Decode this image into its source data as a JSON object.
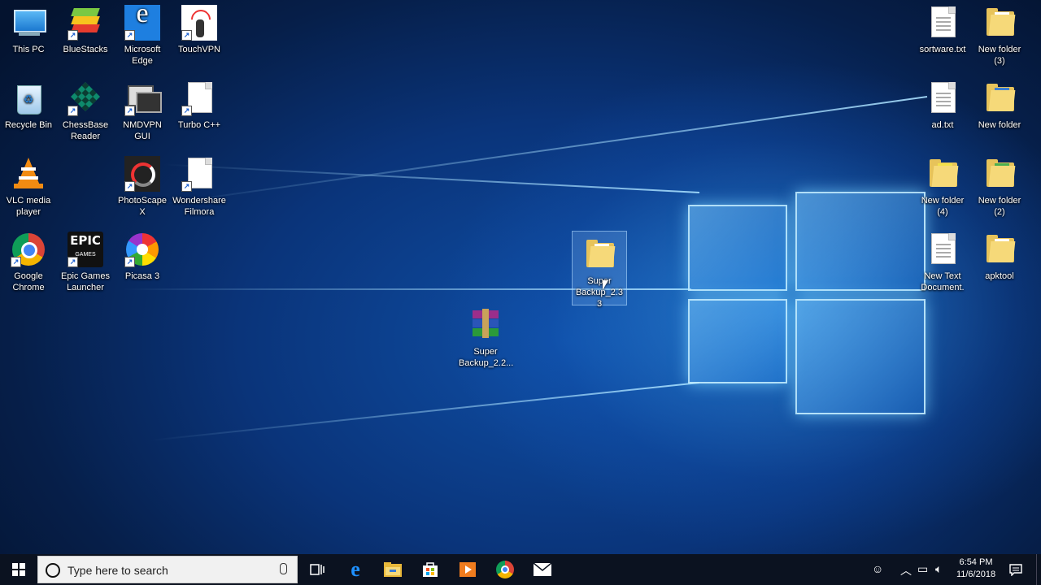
{
  "desktop": {
    "icons_left": [
      {
        "label": "This PC",
        "icon": "computer-icon"
      },
      {
        "label": "BlueStacks",
        "icon": "bluestacks-icon"
      },
      {
        "label": "Microsoft Edge",
        "icon": "edge-icon"
      },
      {
        "label": "TouchVPN",
        "icon": "touchvpn-icon"
      },
      {
        "label": "Recycle Bin",
        "icon": "recycle-bin-icon"
      },
      {
        "label": "ChessBase Reader",
        "icon": "chessbase-icon"
      },
      {
        "label": "NMDVPN GUI",
        "icon": "nmdvpn-icon"
      },
      {
        "label": "Turbo C++",
        "icon": "document-icon"
      },
      {
        "label": "VLC media player",
        "icon": "vlc-icon"
      },
      {
        "label": "PhotoScape X",
        "icon": "photoscape-icon"
      },
      {
        "label": "Wondershare Filmora",
        "icon": "document-icon"
      },
      {
        "label": "Google Chrome",
        "icon": "chrome-icon"
      },
      {
        "label": "Epic Games Launcher",
        "icon": "epic-games-icon"
      },
      {
        "label": "Picasa 3",
        "icon": "picasa-icon"
      }
    ],
    "icons_middle": [
      {
        "label": "Super Backup_2.3 3",
        "icon": "folder-icon"
      },
      {
        "label": "Super Backup_2.2...",
        "icon": "winrar-icon"
      }
    ],
    "icons_right": [
      {
        "label": "sortware.txt",
        "icon": "text-file-icon"
      },
      {
        "label": "New folder (3)",
        "icon": "folder-icon"
      },
      {
        "label": "ad.txt",
        "icon": "text-file-icon"
      },
      {
        "label": "New folder",
        "icon": "folder-icon"
      },
      {
        "label": "New folder (4)",
        "icon": "folder-icon"
      },
      {
        "label": "New folder (2)",
        "icon": "folder-icon"
      },
      {
        "label": "New Text Document.",
        "icon": "text-file-icon"
      },
      {
        "label": "apktool",
        "icon": "folder-icon"
      }
    ],
    "epic_logo_text": "EPIC",
    "epic_logo_sub": "GAMES"
  },
  "taskbar": {
    "search_placeholder": "Type here to search",
    "apps": [
      "task-view-icon",
      "edge-icon",
      "file-explorer-icon",
      "store-icon",
      "media-player-icon",
      "chrome-icon",
      "mail-icon"
    ],
    "clock_time": "6:54 PM",
    "clock_date": "11/6/2018"
  },
  "colors": {
    "taskbar": "#0b1220",
    "desktop_accent": "#1e7fe0",
    "folder": "#f6d979"
  }
}
